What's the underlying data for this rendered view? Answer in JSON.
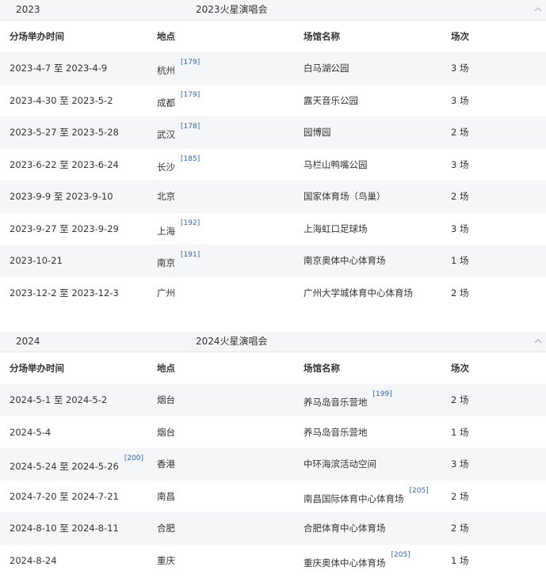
{
  "sections": [
    {
      "year": "2023",
      "title": "2023火星演唱会",
      "headers": [
        "分场举办时间",
        "地点",
        "场馆名称",
        "场次"
      ],
      "rows": [
        {
          "date": "2023-4-7 至 2023-4-9",
          "city": "杭州",
          "city_ref": "[179]",
          "venue": "白马湖公园",
          "shows": "3 场"
        },
        {
          "date": "2023-4-30 至 2023-5-2",
          "city": "成都",
          "city_ref": "[179]",
          "venue": "露天音乐公园",
          "shows": "3 场"
        },
        {
          "date": "2023-5-27 至 2023-5-28",
          "city": "武汉",
          "city_ref": "[178]",
          "venue": "园博园",
          "shows": "2 场"
        },
        {
          "date": "2023-6-22 至 2023-6-24",
          "city": "长沙",
          "city_ref": "[185]",
          "venue": "马栏山鸭嘴公园",
          "shows": "3 场"
        },
        {
          "date": "2023-9-9 至 2023-9-10",
          "city": "北京",
          "venue": "国家体育场（鸟巢）",
          "shows": "2 场"
        },
        {
          "date": "2023-9-27 至 2023-9-29",
          "city": "上海",
          "city_ref": "[192]",
          "venue": "上海虹口足球场",
          "shows": "3 场"
        },
        {
          "date": "2023-10-21",
          "city": "南京",
          "city_ref": "[191]",
          "venue": "南京奥体中心体育场",
          "shows": "1 场"
        },
        {
          "date": "2023-12-2 至 2023-12-3",
          "city": "广州",
          "venue": "广州大学城体育中心体育场",
          "shows": "2 场"
        }
      ]
    },
    {
      "year": "2024",
      "title": "2024火星演唱会",
      "headers": [
        "分场举办时间",
        "地点",
        "场馆名称",
        "场次"
      ],
      "rows": [
        {
          "date": "2024-5-1 至 2024-5-2",
          "city": "烟台",
          "venue": "养马岛音乐营地",
          "venue_ref": "[199]",
          "shows": "2 场"
        },
        {
          "date": "2024-5-4",
          "city": "烟台",
          "venue": "养马岛音乐营地",
          "shows": "1 场"
        },
        {
          "date": "2024-5-24 至 2024-5-26",
          "date_ref": "[200]",
          "city": "香港",
          "venue": "中环海滨活动空间",
          "shows": "3 场"
        },
        {
          "date": "2024-7-20 至 2024-7-21",
          "city": "南昌",
          "venue": "南昌国际体育中心体育场",
          "venue_ref": "[205]",
          "shows": "2 场"
        },
        {
          "date": "2024-8-10 至 2024-8-11",
          "city": "合肥",
          "venue": "合肥体育中心体育场",
          "shows": "2 场"
        },
        {
          "date": "2024-8-24",
          "city": "重庆",
          "venue": "重庆奥体中心体育场",
          "venue_ref": "[205]",
          "shows": "1 场"
        }
      ]
    }
  ]
}
